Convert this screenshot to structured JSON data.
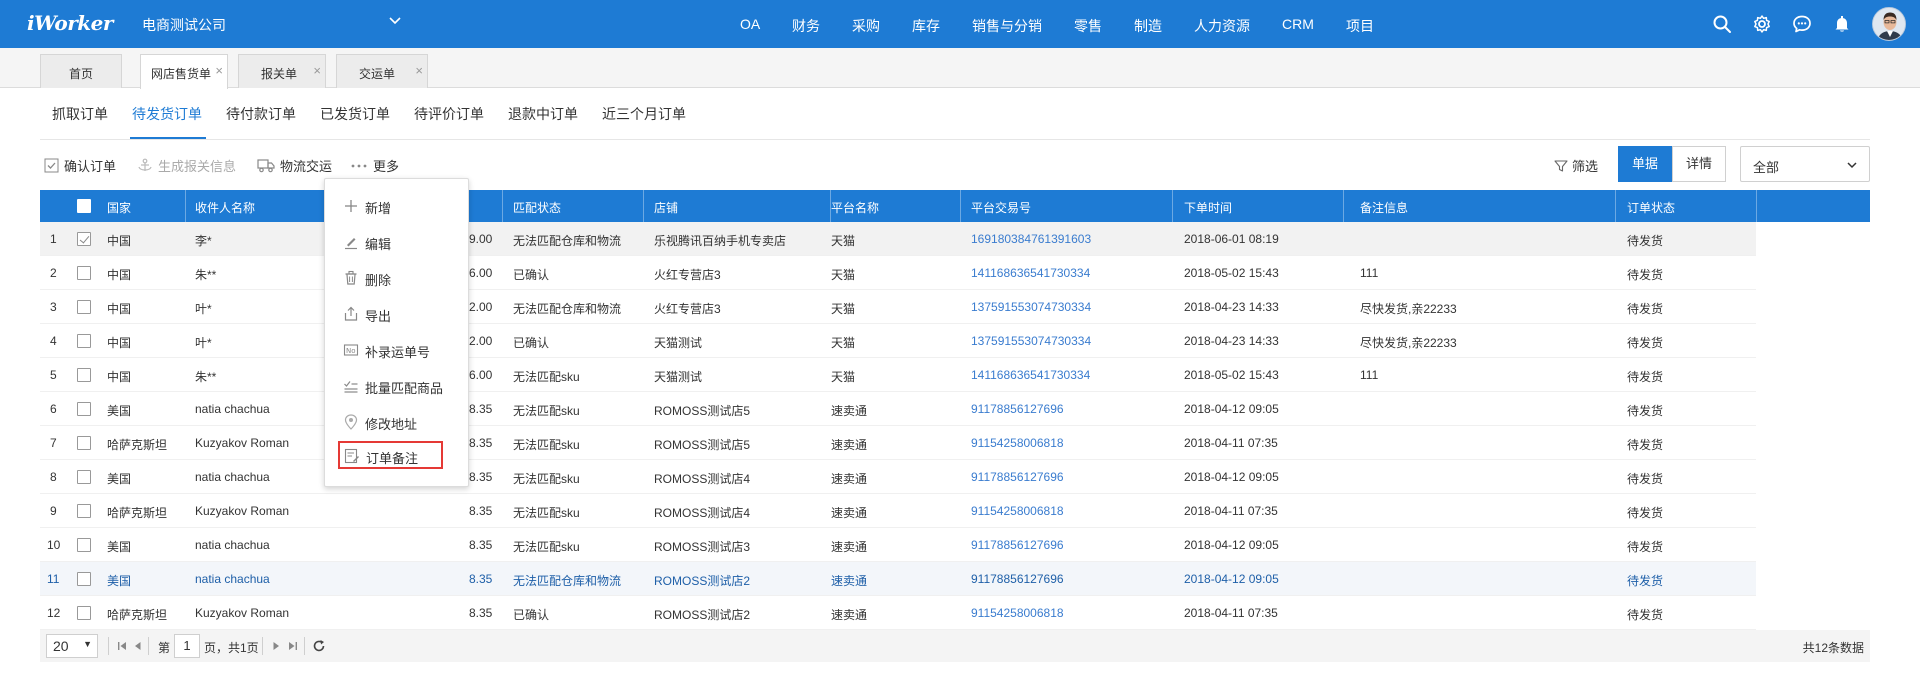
{
  "header": {
    "logo": "iWorker",
    "company": "电商测试公司",
    "nav": [
      "OA",
      "财务",
      "采购",
      "库存",
      "销售与分销",
      "零售",
      "制造",
      "人力资源",
      "CRM",
      "项目"
    ]
  },
  "page_tabs": [
    {
      "label": "首页",
      "closable": false
    },
    {
      "label": "网店售货单",
      "closable": true,
      "active": true
    },
    {
      "label": "报关单",
      "closable": true
    },
    {
      "label": "交运单",
      "closable": true
    }
  ],
  "close_glyph": "×",
  "sub_tabs": [
    "抓取订单",
    "待发货订单",
    "待付款订单",
    "已发货订单",
    "待评价订单",
    "退款中订单",
    "近三个月订单"
  ],
  "active_sub_tab": "待发货订单",
  "toolbar": {
    "confirm": "确认订单",
    "gen_customs": "生成报关信息",
    "logistics": "物流交运",
    "more": "更多",
    "filter": "筛选",
    "view_list": "单据",
    "view_detail": "详情",
    "status_select": "全部"
  },
  "more_menu": [
    "新增",
    "编辑",
    "删除",
    "导出",
    "补录运单号",
    "批量匹配商品",
    "修改地址",
    "订单备注"
  ],
  "table": {
    "headers": [
      "国家",
      "收件人名称",
      "匹配状态",
      "店铺",
      "平台名称",
      "平台交易号",
      "下单时间",
      "备注信息",
      "订单状态"
    ],
    "rows": [
      {
        "no": "1",
        "country": "中国",
        "receiver": "李*",
        "amount": "9.00",
        "match": "无法匹配仓库和物流",
        "shop": "乐视腾讯百纳手机专卖店",
        "platform": "天猫",
        "trade_no": "169180384761391603",
        "time": "2018-06-01 08:19",
        "note": "",
        "status": "待发货"
      },
      {
        "no": "2",
        "country": "中国",
        "receiver": "朱**",
        "amount": "6.00",
        "match": "已确认",
        "shop": "火红专营店3",
        "platform": "天猫",
        "trade_no": "141168636541730334",
        "time": "2018-05-02 15:43",
        "note": "111",
        "status": "待发货"
      },
      {
        "no": "3",
        "country": "中国",
        "receiver": "叶*",
        "amount": "2.00",
        "match": "无法匹配仓库和物流",
        "shop": "火红专营店3",
        "platform": "天猫",
        "trade_no": "137591553074730334",
        "time": "2018-04-23 14:33",
        "note": "尽快发货,亲22233",
        "status": "待发货"
      },
      {
        "no": "4",
        "country": "中国",
        "receiver": "叶*",
        "amount": "2.00",
        "match": "已确认",
        "shop": "天猫测试",
        "platform": "天猫",
        "trade_no": "137591553074730334",
        "time": "2018-04-23 14:33",
        "note": "尽快发货,亲22233",
        "status": "待发货"
      },
      {
        "no": "5",
        "country": "中国",
        "receiver": "朱**",
        "amount": "6.00",
        "match": "无法匹配sku",
        "shop": "天猫测试",
        "platform": "天猫",
        "trade_no": "141168636541730334",
        "time": "2018-05-02 15:43",
        "note": "111",
        "status": "待发货"
      },
      {
        "no": "6",
        "country": "美国",
        "receiver": "natia chachua",
        "amount": "8.35",
        "match": "无法匹配sku",
        "shop": "ROMOSS测试店5",
        "platform": "速卖通",
        "trade_no": "91178856127696",
        "time": "2018-04-12 09:05",
        "note": "",
        "status": "待发货"
      },
      {
        "no": "7",
        "country": "哈萨克斯坦",
        "receiver": "Kuzyakov Roman",
        "amount": "8.35",
        "match": "无法匹配sku",
        "shop": "ROMOSS测试店5",
        "platform": "速卖通",
        "trade_no": "91154258006818",
        "time": "2018-04-11 07:35",
        "note": "",
        "status": "待发货"
      },
      {
        "no": "8",
        "country": "美国",
        "receiver": "natia chachua",
        "amount": "8.35",
        "match": "无法匹配sku",
        "shop": "ROMOSS测试店4",
        "platform": "速卖通",
        "trade_no": "91178856127696",
        "time": "2018-04-12 09:05",
        "note": "",
        "status": "待发货"
      },
      {
        "no": "9",
        "country": "哈萨克斯坦",
        "receiver": "Kuzyakov Roman",
        "amount": "8.35",
        "match": "无法匹配sku",
        "shop": "ROMOSS测试店4",
        "platform": "速卖通",
        "trade_no": "91154258006818",
        "time": "2018-04-11 07:35",
        "note": "",
        "status": "待发货"
      },
      {
        "no": "10",
        "country": "美国",
        "receiver": "natia chachua",
        "amount": "8.35",
        "match": "无法匹配sku",
        "shop": "ROMOSS测试店3",
        "platform": "速卖通",
        "trade_no": "91178856127696",
        "time": "2018-04-12 09:05",
        "note": "",
        "status": "待发货"
      },
      {
        "no": "11",
        "country": "美国",
        "receiver": "natia chachua",
        "amount": "8.35",
        "match": "无法匹配仓库和物流",
        "shop": "ROMOSS测试店2",
        "platform": "速卖通",
        "trade_no": "91178856127696",
        "time": "2018-04-12 09:05",
        "note": "",
        "status": "待发货"
      },
      {
        "no": "12",
        "country": "哈萨克斯坦",
        "receiver": "Kuzyakov Roman",
        "amount": "8.35",
        "match": "已确认",
        "shop": "ROMOSS测试店2",
        "platform": "速卖通",
        "trade_no": "91154258006818",
        "time": "2018-04-11 07:35",
        "note": "",
        "status": "待发货"
      }
    ]
  },
  "pagination": {
    "page_size": "20",
    "page_prefix": "第",
    "page_value": "1",
    "page_suffix": "页，共1页",
    "total": "共12条数据"
  },
  "colors": {
    "brand_blue": "#1e7bd4",
    "link_blue": "#3a7ccf",
    "highlight_red": "#e53935"
  }
}
